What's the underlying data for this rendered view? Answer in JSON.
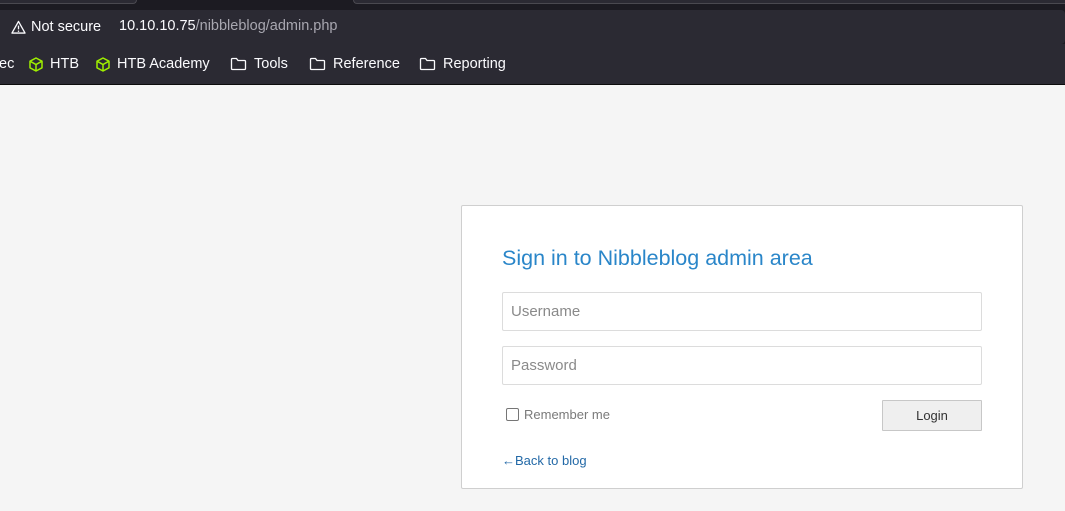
{
  "browser": {
    "security_label": "Not secure",
    "url_host": "10.10.10.75",
    "url_path": "/nibbleblog/admin.php"
  },
  "bookmarks": [
    {
      "label": "ec",
      "icon": "none"
    },
    {
      "label": "HTB",
      "icon": "cube-icon"
    },
    {
      "label": "HTB Academy",
      "icon": "cube-icon"
    },
    {
      "label": "Tools",
      "icon": "folder-icon"
    },
    {
      "label": "Reference",
      "icon": "folder-icon"
    },
    {
      "label": "Reporting",
      "icon": "folder-icon"
    }
  ],
  "login": {
    "title": "Sign in to Nibbleblog admin area",
    "username_placeholder": "Username",
    "password_placeholder": "Password",
    "remember_label": "Remember me",
    "remember_checked": false,
    "login_label": "Login",
    "back_link": "←Back to blog"
  },
  "colors": {
    "title": "#2a86c9",
    "link": "#2369a7",
    "htb_icon": "#9fef00"
  }
}
